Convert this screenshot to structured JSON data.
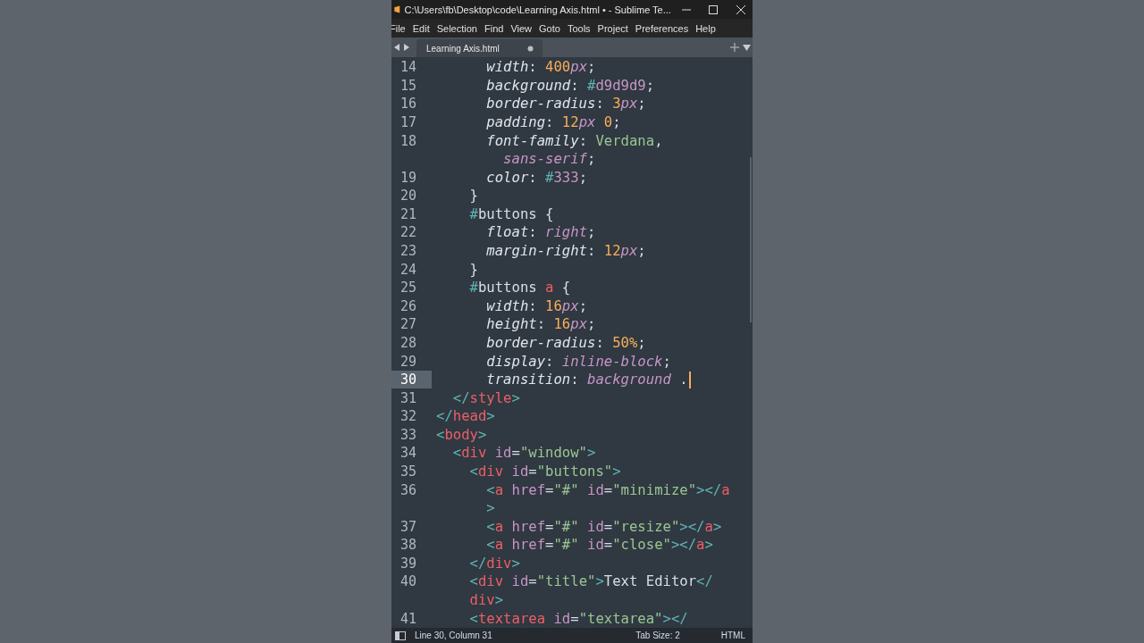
{
  "window": {
    "title": "C:\\Users\\fb\\Desktop\\code\\Learning Axis.html • - Sublime Te..."
  },
  "menu": [
    "File",
    "Edit",
    "Selection",
    "Find",
    "View",
    "Goto",
    "Tools",
    "Project",
    "Preferences",
    "Help"
  ],
  "tabs": [
    {
      "label": "Learning Axis.html",
      "selected": true,
      "modified": true
    }
  ],
  "lines": [
    {
      "number": "14",
      "current": false,
      "rows": [
        {
          "indent": "      ",
          "tokens": [
            {
              "text": "width",
              "kind": "prop"
            },
            {
              "text": ": ",
              "kind": "punct"
            },
            {
              "text": "400",
              "kind": "num"
            },
            {
              "text": "px",
              "kind": "unit"
            },
            {
              "text": ";",
              "kind": "punct"
            }
          ]
        }
      ]
    },
    {
      "number": "15",
      "current": false,
      "rows": [
        {
          "indent": "      ",
          "tokens": [
            {
              "text": "background",
              "kind": "prop"
            },
            {
              "text": ": ",
              "kind": "punct"
            },
            {
              "text": "#",
              "kind": "hash"
            },
            {
              "text": "d9d9d9",
              "kind": "attr"
            },
            {
              "text": ";",
              "kind": "punct"
            }
          ]
        }
      ]
    },
    {
      "number": "16",
      "current": false,
      "rows": [
        {
          "indent": "      ",
          "tokens": [
            {
              "text": "border-radius",
              "kind": "prop"
            },
            {
              "text": ": ",
              "kind": "punct"
            },
            {
              "text": "3",
              "kind": "num"
            },
            {
              "text": "px",
              "kind": "unit"
            },
            {
              "text": ";",
              "kind": "punct"
            }
          ]
        }
      ]
    },
    {
      "number": "17",
      "current": false,
      "rows": [
        {
          "indent": "      ",
          "tokens": [
            {
              "text": "padding",
              "kind": "prop"
            },
            {
              "text": ": ",
              "kind": "punct"
            },
            {
              "text": "12",
              "kind": "num"
            },
            {
              "text": "px",
              "kind": "unit"
            },
            {
              "text": " 0",
              "kind": "num"
            },
            {
              "text": ";",
              "kind": "punct"
            }
          ]
        }
      ]
    },
    {
      "number": "18",
      "current": false,
      "rows": [
        {
          "indent": "      ",
          "tokens": [
            {
              "text": "font-family",
              "kind": "prop"
            },
            {
              "text": ": ",
              "kind": "punct"
            },
            {
              "text": "Verdana",
              "kind": "string"
            },
            {
              "text": ",",
              "kind": "punct"
            }
          ]
        },
        {
          "indent": "        ",
          "tokens": [
            {
              "text": "sans-serif",
              "kind": "unit"
            },
            {
              "text": ";",
              "kind": "punct"
            }
          ]
        }
      ]
    },
    {
      "number": "19",
      "current": false,
      "rows": [
        {
          "indent": "      ",
          "tokens": [
            {
              "text": "color",
              "kind": "prop"
            },
            {
              "text": ": ",
              "kind": "punct"
            },
            {
              "text": "#",
              "kind": "hash"
            },
            {
              "text": "333",
              "kind": "attr"
            },
            {
              "text": ";",
              "kind": "punct"
            }
          ]
        }
      ]
    },
    {
      "number": "20",
      "current": false,
      "rows": [
        {
          "indent": "    ",
          "tokens": [
            {
              "text": "}",
              "kind": "punct"
            }
          ]
        }
      ]
    },
    {
      "number": "21",
      "current": false,
      "rows": [
        {
          "indent": "    ",
          "tokens": [
            {
              "text": "#",
              "kind": "hash"
            },
            {
              "text": "buttons",
              "kind": "plain"
            },
            {
              "text": " {",
              "kind": "punct"
            }
          ]
        }
      ]
    },
    {
      "number": "22",
      "current": false,
      "rows": [
        {
          "indent": "      ",
          "tokens": [
            {
              "text": "float",
              "kind": "prop"
            },
            {
              "text": ": ",
              "kind": "punct"
            },
            {
              "text": "right",
              "kind": "unit"
            },
            {
              "text": ";",
              "kind": "punct"
            }
          ]
        }
      ]
    },
    {
      "number": "23",
      "current": false,
      "rows": [
        {
          "indent": "      ",
          "tokens": [
            {
              "text": "margin-right",
              "kind": "prop"
            },
            {
              "text": ": ",
              "kind": "punct"
            },
            {
              "text": "12",
              "kind": "num"
            },
            {
              "text": "px",
              "kind": "unit"
            },
            {
              "text": ";",
              "kind": "punct"
            }
          ]
        }
      ]
    },
    {
      "number": "24",
      "current": false,
      "rows": [
        {
          "indent": "    ",
          "tokens": [
            {
              "text": "}",
              "kind": "punct"
            }
          ]
        }
      ]
    },
    {
      "number": "25",
      "current": false,
      "rows": [
        {
          "indent": "    ",
          "tokens": [
            {
              "text": "#",
              "kind": "hash"
            },
            {
              "text": "buttons",
              "kind": "plain"
            },
            {
              "text": " a",
              "kind": "tag"
            },
            {
              "text": " {",
              "kind": "punct"
            }
          ]
        }
      ]
    },
    {
      "number": "26",
      "current": false,
      "rows": [
        {
          "indent": "      ",
          "tokens": [
            {
              "text": "width",
              "kind": "prop"
            },
            {
              "text": ": ",
              "kind": "punct"
            },
            {
              "text": "16",
              "kind": "num"
            },
            {
              "text": "px",
              "kind": "unit"
            },
            {
              "text": ";",
              "kind": "punct"
            }
          ]
        }
      ]
    },
    {
      "number": "27",
      "current": false,
      "rows": [
        {
          "indent": "      ",
          "tokens": [
            {
              "text": "height",
              "kind": "prop"
            },
            {
              "text": ": ",
              "kind": "punct"
            },
            {
              "text": "16",
              "kind": "num"
            },
            {
              "text": "px",
              "kind": "unit"
            },
            {
              "text": ";",
              "kind": "punct"
            }
          ]
        }
      ]
    },
    {
      "number": "28",
      "current": false,
      "rows": [
        {
          "indent": "      ",
          "tokens": [
            {
              "text": "border-radius",
              "kind": "prop"
            },
            {
              "text": ": ",
              "kind": "punct"
            },
            {
              "text": "50%",
              "kind": "num"
            },
            {
              "text": ";",
              "kind": "punct"
            }
          ]
        }
      ]
    },
    {
      "number": "29",
      "current": false,
      "rows": [
        {
          "indent": "      ",
          "tokens": [
            {
              "text": "display",
              "kind": "prop"
            },
            {
              "text": ": ",
              "kind": "punct"
            },
            {
              "text": "inline-block",
              "kind": "unit"
            },
            {
              "text": ";",
              "kind": "punct"
            }
          ]
        }
      ]
    },
    {
      "number": "30",
      "current": true,
      "rows": [
        {
          "indent": "      ",
          "tokens": [
            {
              "text": "transition",
              "kind": "prop"
            },
            {
              "text": ": ",
              "kind": "punct"
            },
            {
              "text": "background",
              "kind": "unit"
            },
            {
              "text": " .",
              "kind": "punct"
            }
          ]
        }
      ]
    },
    {
      "number": "31",
      "current": false,
      "rows": [
        {
          "indent": "  ",
          "tokens": [
            {
              "text": "</",
              "kind": "bracket"
            },
            {
              "text": "style",
              "kind": "tag"
            },
            {
              "text": ">",
              "kind": "bracket"
            }
          ]
        }
      ]
    },
    {
      "number": "32",
      "current": false,
      "rows": [
        {
          "indent": "",
          "tokens": [
            {
              "text": "</",
              "kind": "bracket"
            },
            {
              "text": "head",
              "kind": "tag"
            },
            {
              "text": ">",
              "kind": "bracket"
            }
          ]
        }
      ]
    },
    {
      "number": "33",
      "current": false,
      "rows": [
        {
          "indent": "",
          "tokens": [
            {
              "text": "<",
              "kind": "bracket"
            },
            {
              "text": "body",
              "kind": "tag"
            },
            {
              "text": ">",
              "kind": "bracket"
            }
          ]
        }
      ]
    },
    {
      "number": "34",
      "current": false,
      "rows": [
        {
          "indent": "  ",
          "tokens": [
            {
              "text": "<",
              "kind": "bracket"
            },
            {
              "text": "div",
              "kind": "tag"
            },
            {
              "text": " id",
              "kind": "attr"
            },
            {
              "text": "=",
              "kind": "punct"
            },
            {
              "text": "\"window\"",
              "kind": "string"
            },
            {
              "text": ">",
              "kind": "bracket"
            }
          ]
        }
      ]
    },
    {
      "number": "35",
      "current": false,
      "rows": [
        {
          "indent": "    ",
          "tokens": [
            {
              "text": "<",
              "kind": "bracket"
            },
            {
              "text": "div",
              "kind": "tag"
            },
            {
              "text": " id",
              "kind": "attr"
            },
            {
              "text": "=",
              "kind": "punct"
            },
            {
              "text": "\"buttons\"",
              "kind": "string"
            },
            {
              "text": ">",
              "kind": "bracket"
            }
          ]
        }
      ]
    },
    {
      "number": "36",
      "current": false,
      "rows": [
        {
          "indent": "      ",
          "tokens": [
            {
              "text": "<",
              "kind": "bracket"
            },
            {
              "text": "a",
              "kind": "tag"
            },
            {
              "text": " href",
              "kind": "attr"
            },
            {
              "text": "=",
              "kind": "punct"
            },
            {
              "text": "\"#\"",
              "kind": "string"
            },
            {
              "text": " id",
              "kind": "attr"
            },
            {
              "text": "=",
              "kind": "punct"
            },
            {
              "text": "\"minimize\"",
              "kind": "string"
            },
            {
              "text": "></",
              "kind": "bracket"
            },
            {
              "text": "a",
              "kind": "tag"
            }
          ]
        },
        {
          "indent": "      ",
          "tokens": [
            {
              "text": ">",
              "kind": "bracket"
            }
          ]
        }
      ]
    },
    {
      "number": "37",
      "current": false,
      "rows": [
        {
          "indent": "      ",
          "tokens": [
            {
              "text": "<",
              "kind": "bracket"
            },
            {
              "text": "a",
              "kind": "tag"
            },
            {
              "text": " href",
              "kind": "attr"
            },
            {
              "text": "=",
              "kind": "punct"
            },
            {
              "text": "\"#\"",
              "kind": "string"
            },
            {
              "text": " id",
              "kind": "attr"
            },
            {
              "text": "=",
              "kind": "punct"
            },
            {
              "text": "\"resize\"",
              "kind": "string"
            },
            {
              "text": "></",
              "kind": "bracket"
            },
            {
              "text": "a",
              "kind": "tag"
            },
            {
              "text": ">",
              "kind": "bracket"
            }
          ]
        }
      ]
    },
    {
      "number": "38",
      "current": false,
      "rows": [
        {
          "indent": "      ",
          "tokens": [
            {
              "text": "<",
              "kind": "bracket"
            },
            {
              "text": "a",
              "kind": "tag"
            },
            {
              "text": " href",
              "kind": "attr"
            },
            {
              "text": "=",
              "kind": "punct"
            },
            {
              "text": "\"#\"",
              "kind": "string"
            },
            {
              "text": " id",
              "kind": "attr"
            },
            {
              "text": "=",
              "kind": "punct"
            },
            {
              "text": "\"close\"",
              "kind": "string"
            },
            {
              "text": "></",
              "kind": "bracket"
            },
            {
              "text": "a",
              "kind": "tag"
            },
            {
              "text": ">",
              "kind": "bracket"
            }
          ]
        }
      ]
    },
    {
      "number": "39",
      "current": false,
      "rows": [
        {
          "indent": "    ",
          "tokens": [
            {
              "text": "</",
              "kind": "bracket"
            },
            {
              "text": "div",
              "kind": "tag"
            },
            {
              "text": ">",
              "kind": "bracket"
            }
          ]
        }
      ]
    },
    {
      "number": "40",
      "current": false,
      "rows": [
        {
          "indent": "    ",
          "tokens": [
            {
              "text": "<",
              "kind": "bracket"
            },
            {
              "text": "div",
              "kind": "tag"
            },
            {
              "text": " id",
              "kind": "attr"
            },
            {
              "text": "=",
              "kind": "punct"
            },
            {
              "text": "\"title\"",
              "kind": "string"
            },
            {
              "text": ">",
              "kind": "bracket"
            },
            {
              "text": "Text Editor",
              "kind": "plain"
            },
            {
              "text": "</",
              "kind": "bracket"
            }
          ]
        },
        {
          "indent": "    ",
          "tokens": [
            {
              "text": "div",
              "kind": "tag"
            },
            {
              "text": ">",
              "kind": "bracket"
            }
          ]
        }
      ]
    },
    {
      "number": "41",
      "current": false,
      "rows": [
        {
          "indent": "    ",
          "tokens": [
            {
              "text": "<",
              "kind": "bracket"
            },
            {
              "text": "textarea",
              "kind": "tag"
            },
            {
              "text": " id",
              "kind": "attr"
            },
            {
              "text": "=",
              "kind": "punct"
            },
            {
              "text": "\"textarea\"",
              "kind": "string"
            },
            {
              "text": "></",
              "kind": "bracket"
            }
          ]
        }
      ]
    }
  ],
  "status_bar": {
    "position": "Line 30, Column 31",
    "tab_size": "Tab Size: 2",
    "syntax": "HTML"
  }
}
